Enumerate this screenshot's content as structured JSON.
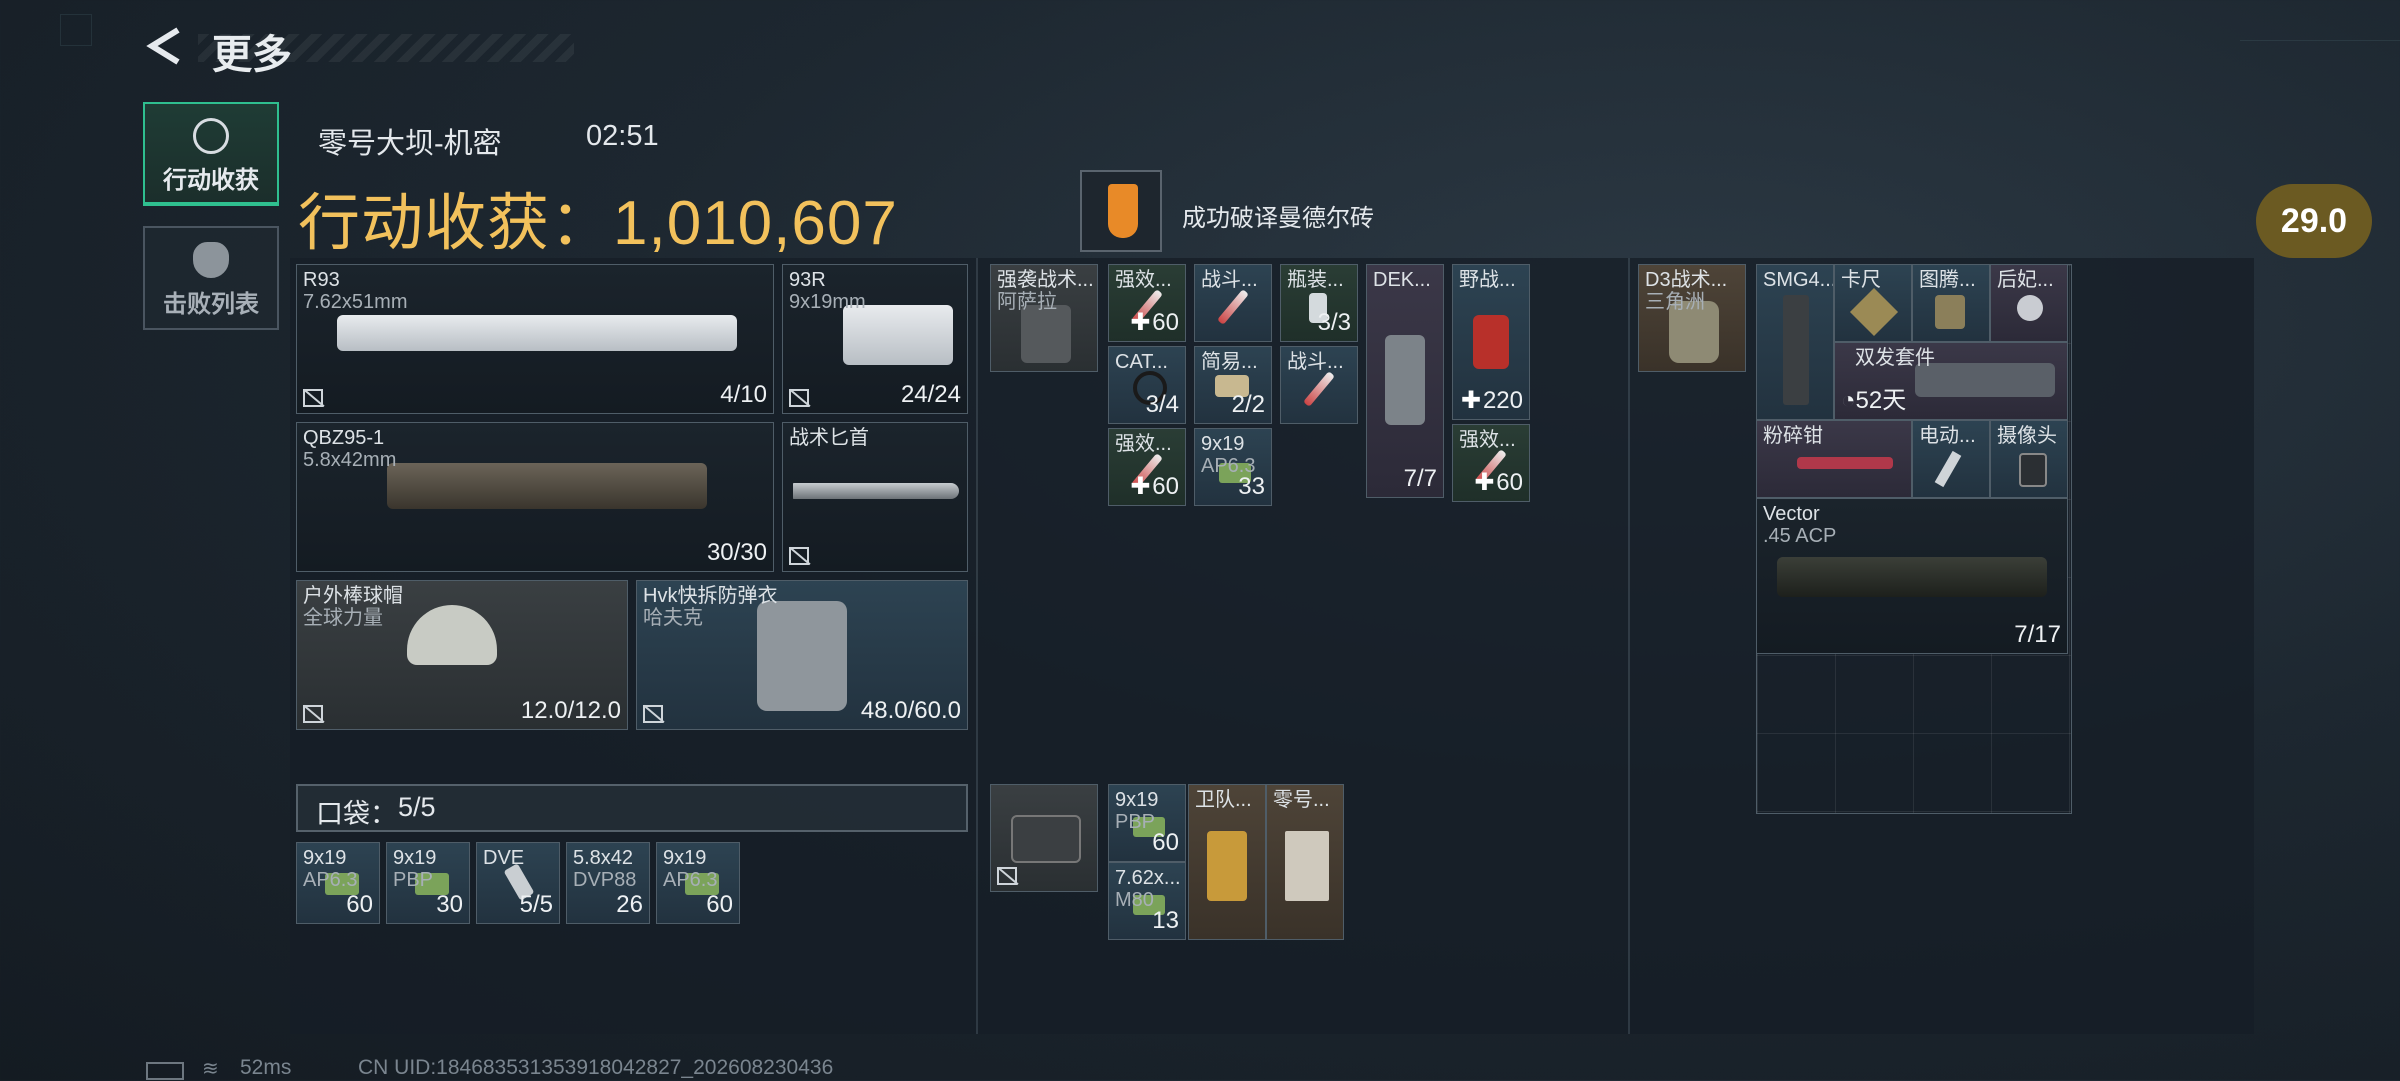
{
  "header": {
    "title": "更多",
    "back_icon": "chevron-left-icon"
  },
  "tabs": [
    {
      "label": "行动收获",
      "icon": "coin-icon",
      "active": true
    },
    {
      "label": "击败列表",
      "icon": "skull-icon",
      "active": false
    }
  ],
  "raid": {
    "map": "零号大坝-机密",
    "time": "02:51"
  },
  "total": {
    "label": "行动收获：1,010,607"
  },
  "achievement": {
    "text": "成功破译曼德尔砖",
    "icon": "shield-icon",
    "color": "#e88a28"
  },
  "score": "29.0",
  "loadout": [
    {
      "name": "R93",
      "sub": "7.62x51mm",
      "count": "4/10"
    },
    {
      "name": "93R",
      "sub": "9x19mm",
      "count": "24/24"
    },
    {
      "name": "QBZ95-1",
      "sub": "5.8x42mm",
      "count": "30/30"
    },
    {
      "name": "战术匕首",
      "sub": "",
      "count": ""
    },
    {
      "name": "户外棒球帽",
      "sub": "全球力量",
      "count": "12.0/12.0"
    },
    {
      "name": "Hvk快拆防弹衣",
      "sub": "哈夫克",
      "count": "48.0/60.0"
    }
  ],
  "pocket": {
    "label": "口袋：",
    "count": "5/5",
    "items": [
      {
        "name": "9x19",
        "sub": "AP6.3",
        "count": "60"
      },
      {
        "name": "9x19",
        "sub": "PBP",
        "count": "30"
      },
      {
        "name": "DVE",
        "sub": "",
        "count": "5/5"
      },
      {
        "name": "5.8x42",
        "sub": "DVP88",
        "count": "26"
      },
      {
        "name": "9x19",
        "sub": "AP6.3",
        "count": "60"
      }
    ]
  },
  "chest_rig": {
    "name": "强袭战术...",
    "sub": "阿萨拉",
    "items": [
      {
        "name": "强效...",
        "count": "60"
      },
      {
        "name": "战斗...",
        "count": ""
      },
      {
        "name": "瓶装...",
        "count": "3/3"
      },
      {
        "name": "CAT...",
        "count": "3/4"
      },
      {
        "name": "简易...",
        "count": "2/2"
      },
      {
        "name": "战斗...",
        "count": ""
      },
      {
        "name": "DEK...",
        "count": "7/7"
      },
      {
        "name": "野战...",
        "count": "220"
      },
      {
        "name": "强效...",
        "count": "60"
      },
      {
        "name": "9x19",
        "sub": "AP6.3",
        "count": "33"
      },
      {
        "name": "强效...",
        "count": "60"
      }
    ]
  },
  "case": {
    "items": [
      {
        "name": "9x19",
        "sub": "PBP",
        "count": "60"
      },
      {
        "name": "卫队...",
        "count": ""
      },
      {
        "name": "零号...",
        "count": ""
      },
      {
        "name": "7.62x...",
        "sub": "M80",
        "count": "13"
      }
    ]
  },
  "backpack": {
    "name": "D3战术...",
    "sub": "三角洲"
  },
  "backpack_items": [
    {
      "name": "SMG4...",
      "count": ""
    },
    {
      "name": "卡尺",
      "count": ""
    },
    {
      "name": "图腾...",
      "count": ""
    },
    {
      "name": "后妃...",
      "count": ""
    },
    {
      "name": "双发套件",
      "count": "52天"
    },
    {
      "name": "粉碎钳",
      "count": ""
    },
    {
      "name": "电动...",
      "count": ""
    },
    {
      "name": "摄像头",
      "count": ""
    },
    {
      "name": "Vector",
      "sub": ".45 ACP",
      "count": "7/17"
    }
  ],
  "footer": {
    "ping": "52ms",
    "uid": "CN UID:1846835313539180428​27_202608230436"
  }
}
